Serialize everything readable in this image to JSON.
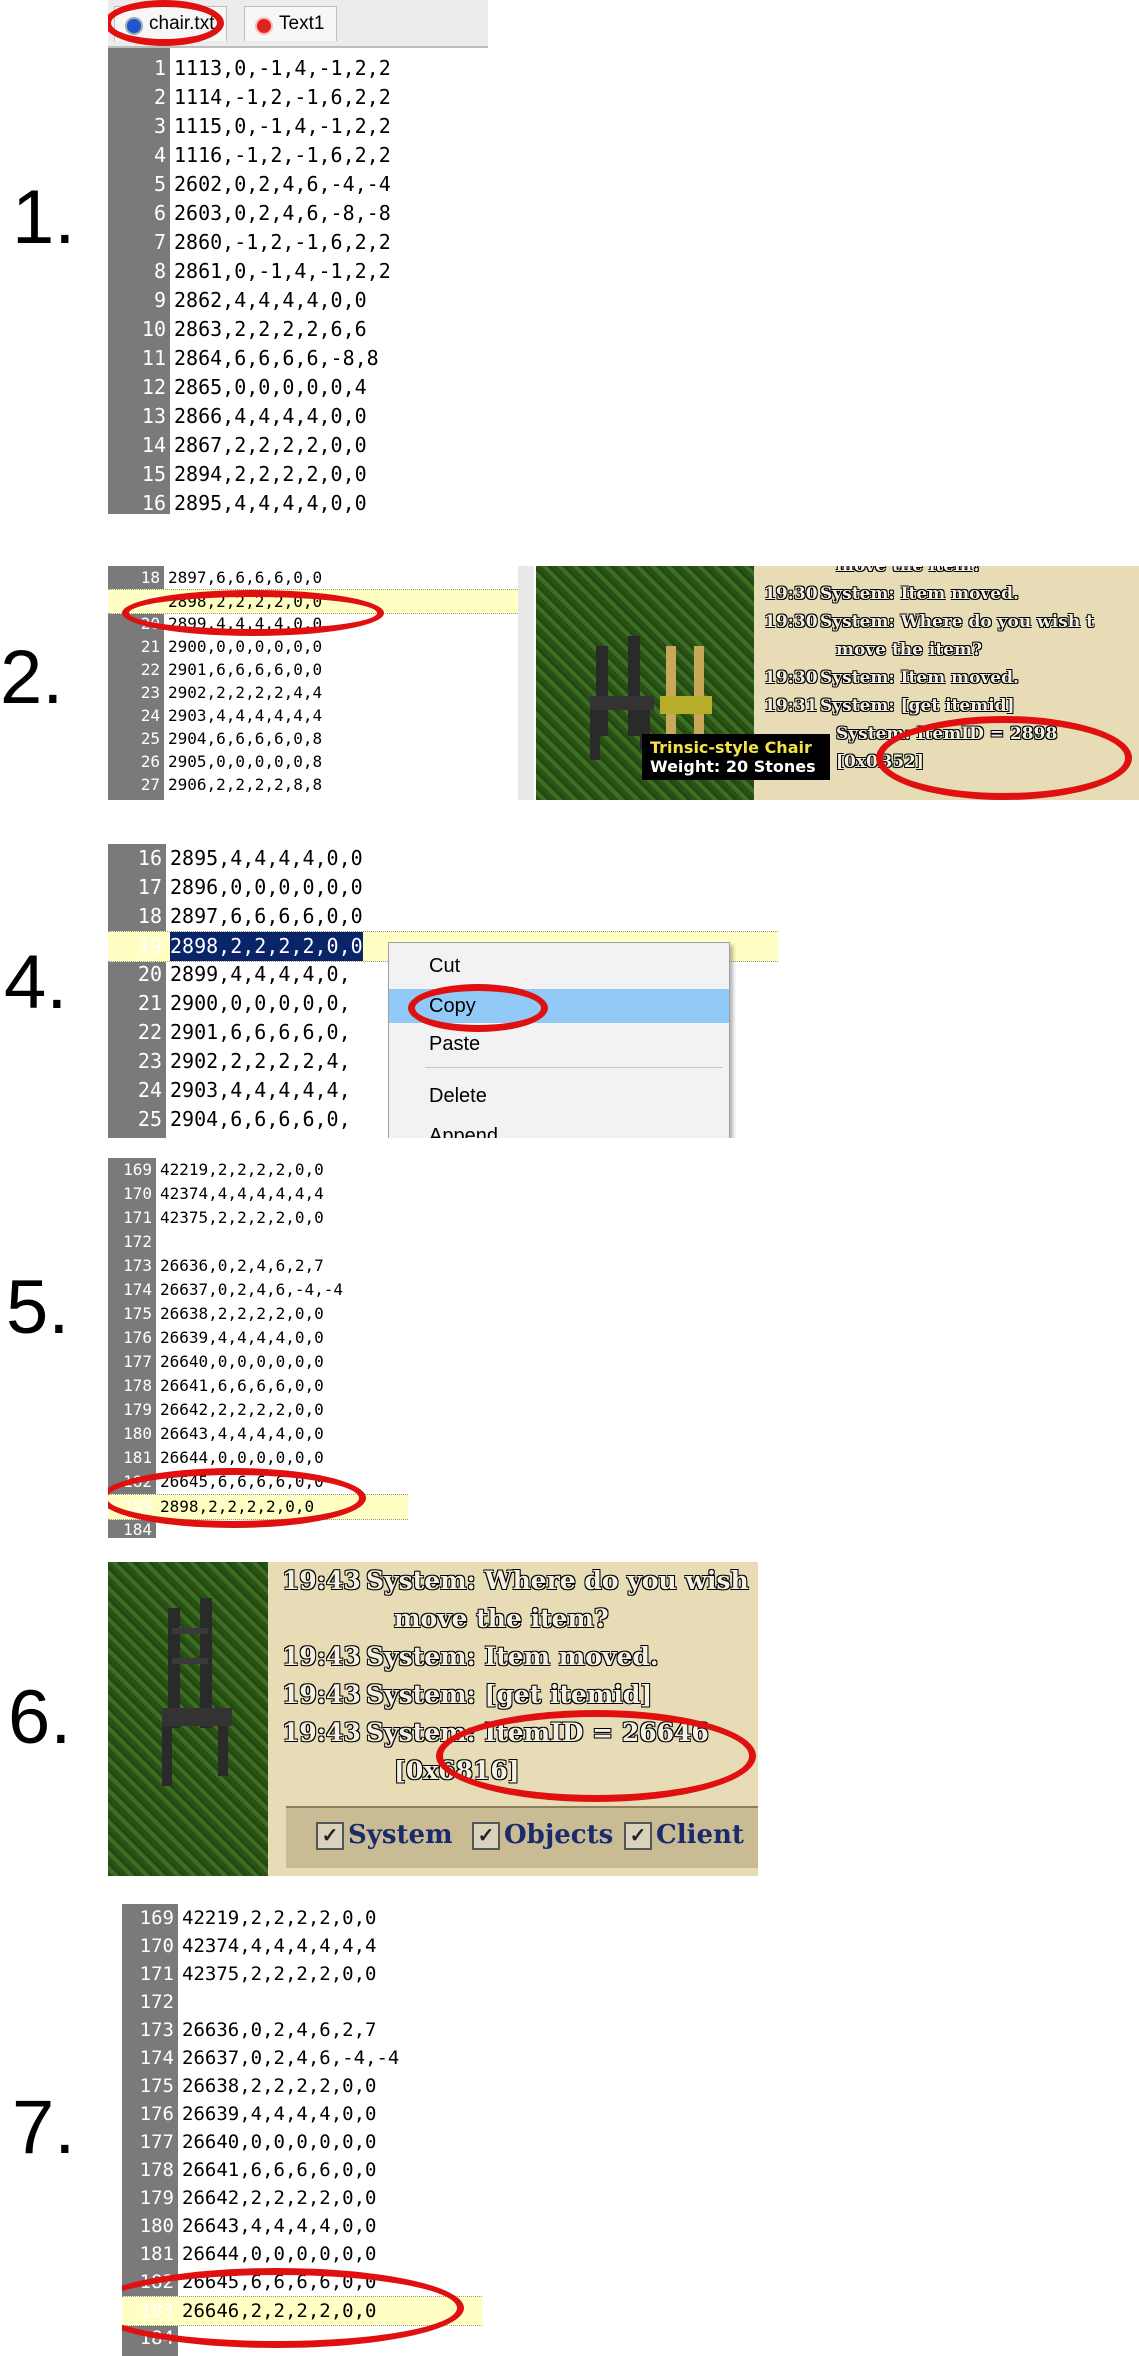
{
  "steps": [
    "1.",
    "2.",
    "4.",
    "5.",
    "6.",
    "7."
  ],
  "step1": {
    "tabs": [
      {
        "label": "chair.txt",
        "color": "#2255cc"
      },
      {
        "label": "Text1",
        "color": "#dd2222"
      }
    ],
    "lines": [
      {
        "n": "1",
        "t": "1113,0,-1,4,-1,2,2"
      },
      {
        "n": "2",
        "t": "1114,-1,2,-1,6,2,2"
      },
      {
        "n": "3",
        "t": "1115,0,-1,4,-1,2,2"
      },
      {
        "n": "4",
        "t": "1116,-1,2,-1,6,2,2"
      },
      {
        "n": "5",
        "t": "2602,0,2,4,6,-4,-4"
      },
      {
        "n": "6",
        "t": "2603,0,2,4,6,-8,-8"
      },
      {
        "n": "7",
        "t": "2860,-1,2,-1,6,2,2"
      },
      {
        "n": "8",
        "t": "2861,0,-1,4,-1,2,2"
      },
      {
        "n": "9",
        "t": "2862,4,4,4,4,0,0"
      },
      {
        "n": "10",
        "t": "2863,2,2,2,2,6,6"
      },
      {
        "n": "11",
        "t": "2864,6,6,6,6,-8,8"
      },
      {
        "n": "12",
        "t": "2865,0,0,0,0,0,4"
      },
      {
        "n": "13",
        "t": "2866,4,4,4,4,0,0"
      },
      {
        "n": "14",
        "t": "2867,2,2,2,2,0,0"
      },
      {
        "n": "15",
        "t": "2894,2,2,2,2,0,0"
      },
      {
        "n": "16",
        "t": "2895,4,4,4,4,0,0"
      }
    ]
  },
  "step2": {
    "lines": [
      {
        "n": "18",
        "t": "2897,6,6,6,6,0,0"
      },
      {
        "n": "19",
        "t": "2898,2,2,2,2,0,0"
      },
      {
        "n": "20",
        "t": "2899,4,4,4,4,0,0"
      },
      {
        "n": "21",
        "t": "2900,0,0,0,0,0,0"
      },
      {
        "n": "22",
        "t": "2901,6,6,6,6,0,0"
      },
      {
        "n": "23",
        "t": "2902,2,2,2,2,4,4"
      },
      {
        "n": "24",
        "t": "2903,4,4,4,4,4,4"
      },
      {
        "n": "25",
        "t": "2904,6,6,6,6,0,8"
      },
      {
        "n": "26",
        "t": "2905,0,0,0,0,0,8"
      },
      {
        "n": "27",
        "t": "2906,2,2,2,2,8,8"
      }
    ],
    "journal": [
      {
        "time": "",
        "text": "move the item?"
      },
      {
        "time": "19:30",
        "text": "System: Item moved."
      },
      {
        "time": "19:30",
        "text": "System: Where do you wish t"
      },
      {
        "time": "",
        "text": "move the item?"
      },
      {
        "time": "19:30",
        "text": "System: Item moved."
      },
      {
        "time": "19:31",
        "text": "System: [get itemid]"
      },
      {
        "time": "",
        "text": "System: ItemID = 2898"
      },
      {
        "time": "",
        "text": "[0x0B52]"
      }
    ],
    "tooltip_title": "Trinsic-style Chair",
    "tooltip_weight": "Weight: 20 Stones",
    "tooltip_title_color": "#f5e14a"
  },
  "step4": {
    "lines": [
      {
        "n": "16",
        "t": "2895,4,4,4,4,0,0"
      },
      {
        "n": "17",
        "t": "2896,0,0,0,0,0,0"
      },
      {
        "n": "18",
        "t": "2897,6,6,6,6,0,0"
      },
      {
        "n": "19",
        "t": "2898,2,2,2,2,0,0"
      },
      {
        "n": "20",
        "t": "2899,4,4,4,4,0,"
      },
      {
        "n": "21",
        "t": "2900,0,0,0,0,0,"
      },
      {
        "n": "22",
        "t": "2901,6,6,6,6,0,"
      },
      {
        "n": "23",
        "t": "2902,2,2,2,2,4,"
      },
      {
        "n": "24",
        "t": "2903,4,4,4,4,4,"
      },
      {
        "n": "25",
        "t": "2904,6,6,6,6,0,"
      }
    ],
    "menu": [
      "Cut",
      "Copy",
      "Paste",
      "Delete",
      "Append"
    ]
  },
  "step5": {
    "lines": [
      {
        "n": "169",
        "t": "42219,2,2,2,2,0,0"
      },
      {
        "n": "170",
        "t": "42374,4,4,4,4,4,4"
      },
      {
        "n": "171",
        "t": "42375,2,2,2,2,0,0"
      },
      {
        "n": "172",
        "t": ""
      },
      {
        "n": "173",
        "t": "26636,0,2,4,6,2,7"
      },
      {
        "n": "174",
        "t": "26637,0,2,4,6,-4,-4"
      },
      {
        "n": "175",
        "t": "26638,2,2,2,2,0,0"
      },
      {
        "n": "176",
        "t": "26639,4,4,4,4,0,0"
      },
      {
        "n": "177",
        "t": "26640,0,0,0,0,0,0"
      },
      {
        "n": "178",
        "t": "26641,6,6,6,6,0,0"
      },
      {
        "n": "179",
        "t": "26642,2,2,2,2,0,0"
      },
      {
        "n": "180",
        "t": "26643,4,4,4,4,0,0"
      },
      {
        "n": "181",
        "t": "26644,0,0,0,0,0,0"
      },
      {
        "n": "182",
        "t": "26645,6,6,6,6,0,0"
      },
      {
        "n": "183",
        "t": "2898,2,2,2,2,0,0"
      },
      {
        "n": "184",
        "t": ""
      }
    ]
  },
  "step6": {
    "journal": [
      {
        "time": "19:43",
        "text": "System: Where do you wish"
      },
      {
        "time": "",
        "text": "move the item?"
      },
      {
        "time": "19:43",
        "text": "System: Item moved."
      },
      {
        "time": "19:43",
        "text": "System: [get itemid]"
      },
      {
        "time": "19:43",
        "text": "System: ItemID = 26646"
      },
      {
        "time": "",
        "text": "[0x6816]"
      }
    ],
    "checks": [
      "System",
      "Objects",
      "Client"
    ],
    "check_mark": "✓"
  },
  "step7": {
    "lines": [
      {
        "n": "169",
        "t": "42219,2,2,2,2,0,0"
      },
      {
        "n": "170",
        "t": "42374,4,4,4,4,4,4"
      },
      {
        "n": "171",
        "t": "42375,2,2,2,2,0,0"
      },
      {
        "n": "172",
        "t": ""
      },
      {
        "n": "173",
        "t": "26636,0,2,4,6,2,7"
      },
      {
        "n": "174",
        "t": "26637,0,2,4,6,-4,-4"
      },
      {
        "n": "175",
        "t": "26638,2,2,2,2,0,0"
      },
      {
        "n": "176",
        "t": "26639,4,4,4,4,0,0"
      },
      {
        "n": "177",
        "t": "26640,0,0,0,0,0,0"
      },
      {
        "n": "178",
        "t": "26641,6,6,6,6,0,0"
      },
      {
        "n": "179",
        "t": "26642,2,2,2,2,0,0"
      },
      {
        "n": "180",
        "t": "26643,4,4,4,4,0,0"
      },
      {
        "n": "181",
        "t": "26644,0,0,0,0,0,0"
      },
      {
        "n": "182",
        "t": "26645,6,6,6,6,0,0"
      },
      {
        "n": "183",
        "t": "26646,2,2,2,2,0,0"
      },
      {
        "n": "184",
        "t": ""
      }
    ]
  },
  "colors": {
    "annotation_red": "#e01010",
    "line_highlight": "#ffffc4",
    "selection": "#0a246a",
    "menu_active": "#91c9f7",
    "gutter": "#7a7a7a"
  }
}
